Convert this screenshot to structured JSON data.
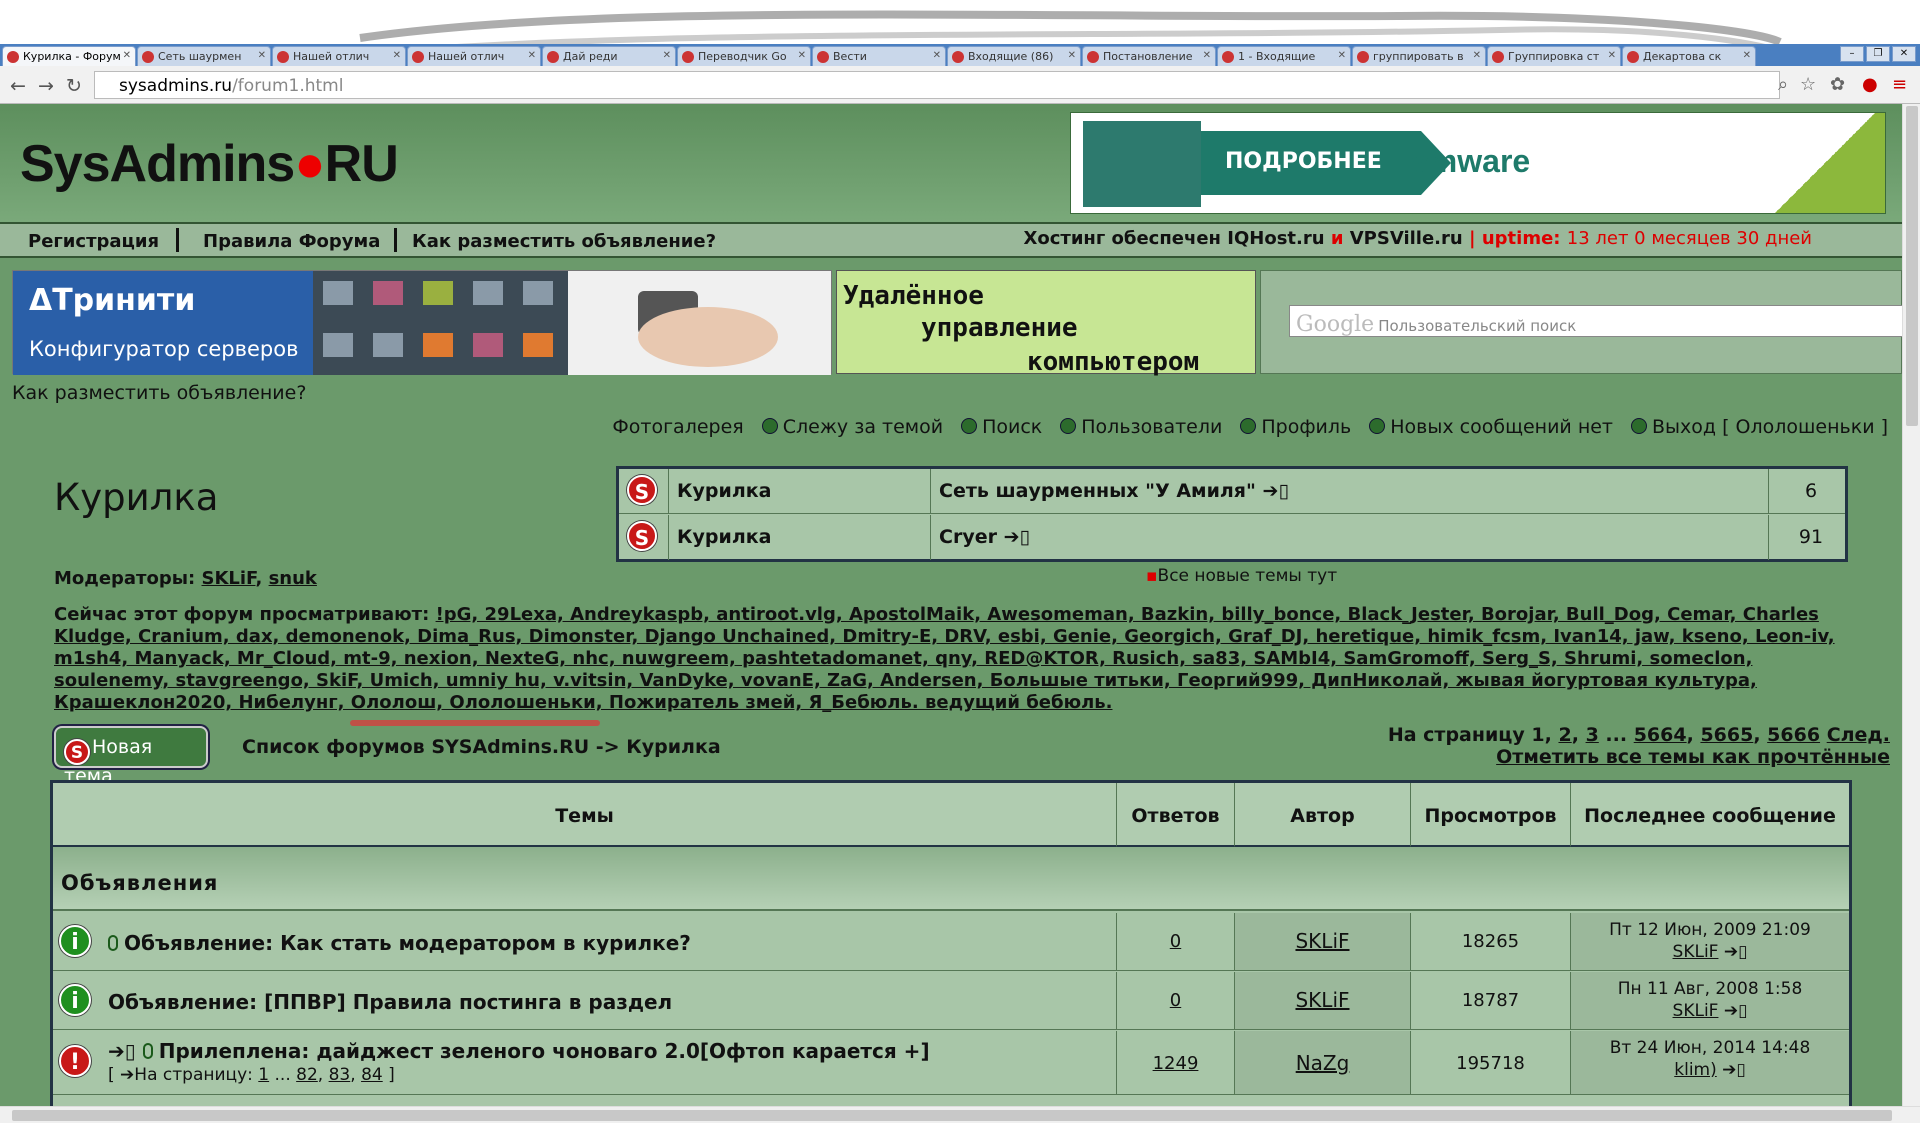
{
  "browser": {
    "tabs": [
      {
        "label": "Курилка - Форум"
      },
      {
        "label": "Сеть шаурмен"
      },
      {
        "label": "Нашей отлич"
      },
      {
        "label": "Нашей отлич"
      },
      {
        "label": "Дай реди"
      },
      {
        "label": "Переводчик Go"
      },
      {
        "label": "Вести"
      },
      {
        "label": "Входящие (86)"
      },
      {
        "label": "Постановление"
      },
      {
        "label": "1 - Входящие"
      },
      {
        "label": "группировать в"
      },
      {
        "label": "Группировка ст"
      },
      {
        "label": "Декартова ск"
      }
    ],
    "url_host": "sysadmins.ru",
    "url_path": "/forum1.html"
  },
  "header": {
    "logo_text": "SysAdmins",
    "logo_domain": "RU",
    "banner": {
      "cta": "ПОДРОБНЕЕ",
      "brand": "vmware"
    }
  },
  "menu": {
    "items": [
      "Регистрация",
      "Правила Форума",
      "Как разместить объявление?"
    ],
    "hosting_prefix": "Хостинг обеспечен",
    "host1": "IQHost.ru",
    "and": "и",
    "host2": "VPSVille.ru",
    "uptime_label": "uptime:",
    "uptime_value": "13 лет 0 месяцев 30 дней"
  },
  "ads": {
    "trinity_title": "Тринити",
    "trinity_sub": "Конфигуратор серверов",
    "remote_lines": [
      "Удалённое",
      "управление",
      "компьютером"
    ],
    "search_placeholder": "Пользовательский поиск",
    "search_brand": "Google"
  },
  "howto_link": "Как разместить объявление?",
  "toplinks": {
    "gallery": "Фотогалерея",
    "watch": "Слежу за темой",
    "search": "Поиск",
    "users": "Пользователи",
    "profile": "Профиль",
    "messages": "Новых сообщений нет",
    "logout": "Выход [ Ололошеньки ]"
  },
  "forum": {
    "title": "Курилка",
    "moderators_label": "Модераторы:",
    "moderators": [
      "SKLiF",
      "snuk"
    ],
    "viewers_label": "Сейчас этот форум просматривают:",
    "viewers_text": "!pG, 29Lexa, Andreykaspb, antiroot.vlg, ApostolMaik, Awesomeman, Bazkin, billy_bonce, Black_Jester, Borojar, Bull_Dog, Cemar, Charles Kludge, Cranium, dax, demonenok, Dima_Rus, Dimonster, Django Unchained, Dmitry-E, DRV, esbi, Genie, Georgich, Graf_DJ, heretique, himik_fcsm, Ivan14, jaw, kseno, Leon-iv, m1sh4, Manyack, Mr_Cloud, mt-9, nexion, NexteG, nhc, nuwgreem, pashtetadomanet, qny, RED@KTOR, Rusich, sa83, SAMbI4, SamGromoff, Serg_S, Shrumi, someclon, soulenemy, stavgreengo, SkiF, Umich, umniy hu, v.vitsin, VanDyke, vovanE, ZaG, Andersen, Большые титьки, Георгий999, ДипНиколай, жывая йогуртовая культура, Крашеклон2020, Нибелунг, Ололош, Ололошеньки, Пожиратель змей, Я_Бебюль. ведущий бебюль.",
    "new_topic_btn": "Новая тема",
    "breadcrumb": "Список форумов SYSAdmins.RU -> Курилка",
    "pages_label": "На страницу",
    "pages": [
      "1",
      "2",
      "3",
      "...",
      "5664",
      "5665",
      "5666"
    ],
    "next": "След.",
    "mark_read": "Отметить все темы как прочтённые",
    "all_new": "Все новые темы тут"
  },
  "new_topics": [
    {
      "forum": "Курилка",
      "topic": "Сеть шаурменных \"У Амиля\"",
      "count": "6"
    },
    {
      "forum": "Курилка",
      "topic": "Cryer",
      "count": "91"
    }
  ],
  "table": {
    "headers": [
      "Темы",
      "Ответов",
      "Автор",
      "Просмотров",
      "Последнее сообщение"
    ],
    "section": "Объявления",
    "rows": [
      {
        "title": "Объявление: Как стать модератором в курилке?",
        "replies": "0",
        "author": "SKLiF",
        "views": "18265",
        "last_date": "Пт 12 Июн, 2009 21:09",
        "last_user": "SKLiF"
      },
      {
        "title": "Объявление: [ППВР] Правила постинга в раздел",
        "replies": "0",
        "author": "SKLiF",
        "views": "18787",
        "last_date": "Пн 11 Авг, 2008 1:58",
        "last_user": "SKLiF"
      },
      {
        "title": "Прилеплена: дайджест зеленого чоноваго 2.0[Офтоп карается +]",
        "replies": "1249",
        "author": "NaZg",
        "views": "195718",
        "last_date": "Вт 24 Июн, 2014 14:48",
        "last_user": "klim)",
        "pages_prefix": "[ ",
        "pages_label": "На страницу:",
        "pages": [
          "1",
          "...",
          "82",
          "83",
          "84"
        ],
        "pages_suffix": "]"
      }
    ]
  },
  "colors": {
    "page_bg": "#6b9a6b",
    "accent_red": "#d00000",
    "table_bg": "#a8c6a8"
  }
}
